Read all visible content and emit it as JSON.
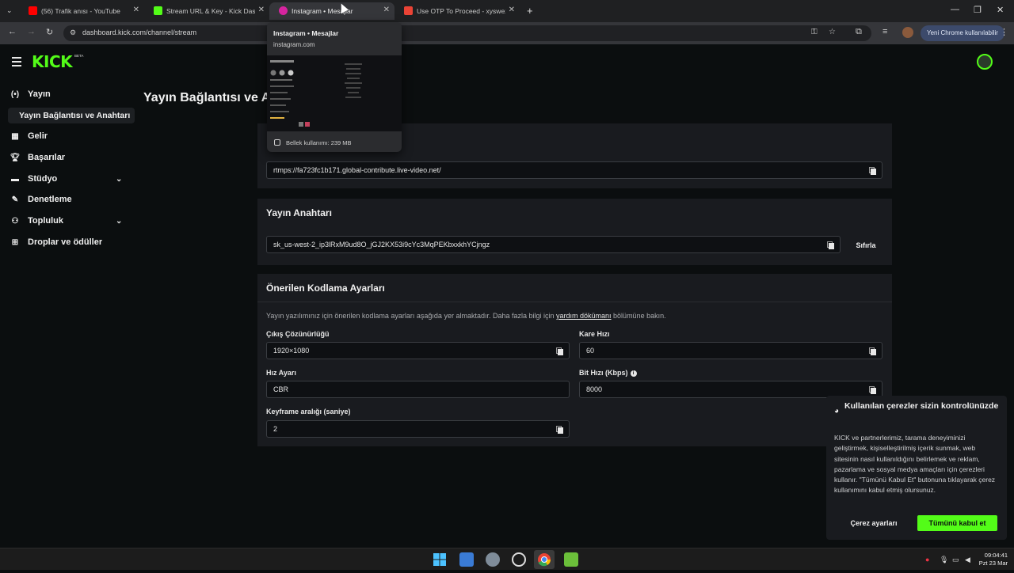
{
  "browser": {
    "tabs": [
      {
        "title": "(56) Trafik anısı - YouTube",
        "favicon_color": "#ff0000"
      },
      {
        "title": "Stream URL & Key - Kick Dashbo",
        "favicon_color": "#53fc18"
      },
      {
        "title": "Instagram • Mesajlar",
        "favicon_color": "#d6249f"
      },
      {
        "title": "Use OTP To Proceed - xyswezy@",
        "favicon_color": "#ea4335"
      }
    ],
    "url": "dashboard.kick.com/channel/stream",
    "new_chrome_label": "Yeni Chrome kullanılabilir",
    "hover_card": {
      "title": "Instagram • Mesajlar",
      "domain": "instagram.com",
      "memory": "Bellek kullanımı: 239 MB"
    }
  },
  "kick": {
    "logo_text": "KICK",
    "beta_label": "BETA",
    "brand_color": "#53fc18",
    "page_title": "Yayın Bağlantısı ve A",
    "sidebar": [
      {
        "label": "Yayın",
        "icon": "broadcast-icon"
      },
      {
        "label": "Gelir",
        "icon": "revenue-icon"
      },
      {
        "label": "Başarılar",
        "icon": "trophy-icon"
      },
      {
        "label": "Stüdyo",
        "icon": "studio-icon"
      },
      {
        "label": "Denetleme",
        "icon": "wrench-icon"
      },
      {
        "label": "Topluluk",
        "icon": "people-icon"
      },
      {
        "label": "Droplar ve ödüller",
        "icon": "drops-icon"
      }
    ],
    "sidebar_sub": "Yayın Bağlantısı ve Anahtarı",
    "stream_url": "rtmps://fa723fc1b171.global-contribute.live-video.net/",
    "stream_key_section": {
      "title": "Yayın Anahtarı",
      "value": "sk_us-west-2_ip3lRxM9ud8O_jGJ2KX53i9cYc3MqPEKbxxkhYCjngz",
      "reset_label": "Sıfırla"
    },
    "encoding": {
      "title": "Önerilen Kodlama Ayarları",
      "description_before": "Yayın yazılımınız için önerilen kodlama ayarları aşağıda yer almaktadır. Daha fazla bilgi için ",
      "description_link": "yardım dökümanı",
      "description_after": " bölümüne bakın.",
      "resolution_label": "Çıkış Çözünürlüğü",
      "resolution_value": "1920×1080",
      "framerate_label": "Kare Hızı",
      "framerate_value": "60",
      "rate_control_label": "Hız Ayarı",
      "rate_control_value": "CBR",
      "bitrate_label": "Bit Hızı (Kbps)",
      "bitrate_value": "8000",
      "keyframe_label": "Keyframe aralığı (saniye)",
      "keyframe_value": "2"
    },
    "cookie": {
      "title": "Kullanılan çerezler sizin kontrolünüzde",
      "body": "KICK ve partnerlerimiz, tarama deneyiminizi geliştirmek, kişiselleştirilmiş içerik sunmak, web sitesinin nasıl kullanıldığını belirlemek ve reklam, pazarlama ve sosyal medya amaçları için çerezleri kullanır. \"Tümünü Kabul Et\" butonuna tıklayarak çerez kullanımını kabul etmiş olursunuz.",
      "settings_label": "Çerez ayarları",
      "accept_label": "Tümünü kabul et"
    }
  },
  "taskbar": {
    "time": "09:04:41",
    "date": "Pzt 23 Mar"
  }
}
